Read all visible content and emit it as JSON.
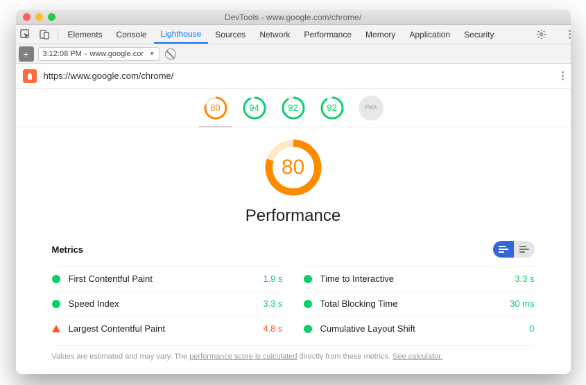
{
  "window": {
    "title": "DevTools - www.google.com/chrome/"
  },
  "tabs": [
    "Elements",
    "Console",
    "Lighthouse",
    "Sources",
    "Network",
    "Performance",
    "Memory",
    "Application",
    "Security"
  ],
  "active_tab": "Lighthouse",
  "record": {
    "time": "3:12:08 PM",
    "origin": "www.google.cor"
  },
  "url": "https://www.google.com/chrome/",
  "scores": [
    {
      "value": 80,
      "status": "orange",
      "active": true
    },
    {
      "value": 94,
      "status": "green"
    },
    {
      "value": 92,
      "status": "green"
    },
    {
      "value": 92,
      "status": "green"
    },
    {
      "label": "PWA",
      "status": "gray"
    }
  ],
  "main": {
    "score": 80,
    "category": "Performance"
  },
  "metrics_header": "Metrics",
  "metrics": [
    {
      "name": "First Contentful Paint",
      "value": "1.9 s",
      "status": "pass"
    },
    {
      "name": "Time to Interactive",
      "value": "3.3 s",
      "status": "pass"
    },
    {
      "name": "Speed Index",
      "value": "3.3 s",
      "status": "pass"
    },
    {
      "name": "Total Blocking Time",
      "value": "30 ms",
      "status": "pass"
    },
    {
      "name": "Largest Contentful Paint",
      "value": "4.8 s",
      "status": "warn"
    },
    {
      "name": "Cumulative Layout Shift",
      "value": "0",
      "status": "pass"
    }
  ],
  "footnote": {
    "a": "Values are estimated and may vary. The ",
    "b": "performance score is calculated",
    "c": " directly from these metrics. ",
    "d": "See calculator."
  },
  "chart_data": {
    "type": "gauge",
    "title": "Performance",
    "values": [
      80,
      94,
      92,
      92
    ],
    "categories": [
      "Performance",
      "",
      "",
      "",
      "PWA"
    ],
    "ylim": [
      0,
      100
    ]
  }
}
